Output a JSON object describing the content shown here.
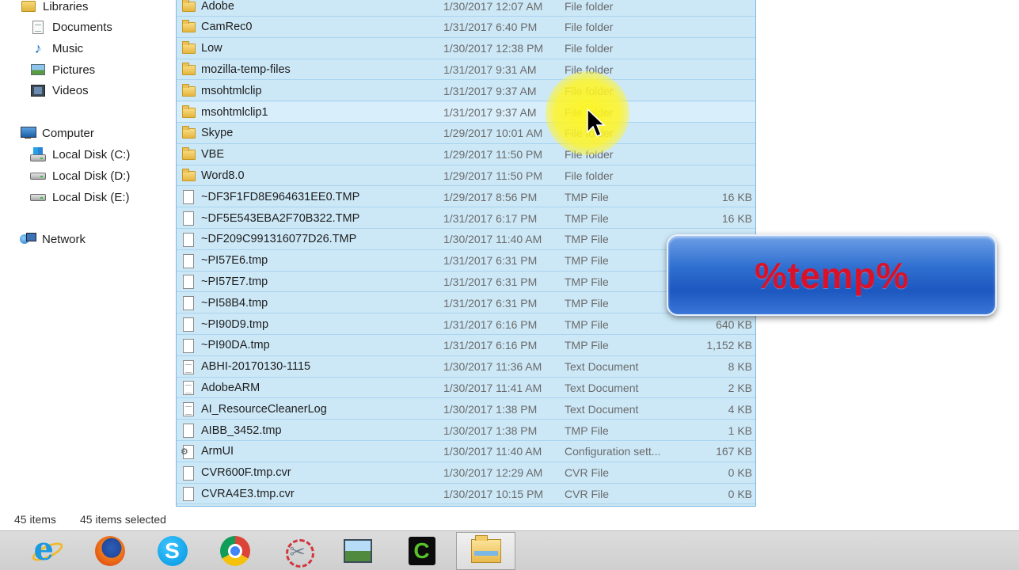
{
  "nav": {
    "items": [
      {
        "label": "Libraries",
        "icon": "libraries-icon"
      },
      {
        "label": "Documents",
        "icon": "documents-icon"
      },
      {
        "label": "Music",
        "icon": "music-icon"
      },
      {
        "label": "Pictures",
        "icon": "pictures-icon"
      },
      {
        "label": "Videos",
        "icon": "videos-icon"
      },
      {
        "label": "Computer",
        "icon": "computer-icon"
      },
      {
        "label": "Local Disk (C:)",
        "icon": "local-disk-c-icon"
      },
      {
        "label": "Local Disk (D:)",
        "icon": "local-disk-icon"
      },
      {
        "label": "Local Disk (E:)",
        "icon": "local-disk-icon"
      },
      {
        "label": "Network",
        "icon": "network-icon"
      }
    ]
  },
  "files": [
    {
      "name": "Adobe",
      "date": "1/30/2017 12:07 AM",
      "type": "File folder",
      "size": "",
      "kind": "folder"
    },
    {
      "name": "CamRec0",
      "date": "1/31/2017 6:40 PM",
      "type": "File folder",
      "size": "",
      "kind": "folder"
    },
    {
      "name": "Low",
      "date": "1/30/2017 12:38 PM",
      "type": "File folder",
      "size": "",
      "kind": "folder"
    },
    {
      "name": "mozilla-temp-files",
      "date": "1/31/2017 9:31 AM",
      "type": "File folder",
      "size": "",
      "kind": "folder"
    },
    {
      "name": "msohtmlclip",
      "date": "1/31/2017 9:37 AM",
      "type": "File folder",
      "size": "",
      "kind": "folder"
    },
    {
      "name": "msohtmlclip1",
      "date": "1/31/2017 9:37 AM",
      "type": "File folder",
      "size": "",
      "kind": "folder"
    },
    {
      "name": "Skype",
      "date": "1/29/2017 10:01 AM",
      "type": "File folder",
      "size": "",
      "kind": "folder"
    },
    {
      "name": "VBE",
      "date": "1/29/2017 11:50 PM",
      "type": "File folder",
      "size": "",
      "kind": "folder"
    },
    {
      "name": "Word8.0",
      "date": "1/29/2017 11:50 PM",
      "type": "File folder",
      "size": "",
      "kind": "folder"
    },
    {
      "name": "~DF3F1FD8E964631EE0.TMP",
      "date": "1/29/2017 8:56 PM",
      "type": "TMP File",
      "size": "16 KB",
      "kind": "file"
    },
    {
      "name": "~DF5E543EBA2F70B322.TMP",
      "date": "1/31/2017 6:17 PM",
      "type": "TMP File",
      "size": "16 KB",
      "kind": "file"
    },
    {
      "name": "~DF209C991316077D26.TMP",
      "date": "1/30/2017 11:40 AM",
      "type": "TMP File",
      "size": "",
      "kind": "file"
    },
    {
      "name": "~PI57E6.tmp",
      "date": "1/31/2017 6:31 PM",
      "type": "TMP File",
      "size": "",
      "kind": "file"
    },
    {
      "name": "~PI57E7.tmp",
      "date": "1/31/2017 6:31 PM",
      "type": "TMP File",
      "size": "",
      "kind": "file"
    },
    {
      "name": "~PI58B4.tmp",
      "date": "1/31/2017 6:31 PM",
      "type": "TMP File",
      "size": "",
      "kind": "file"
    },
    {
      "name": "~PI90D9.tmp",
      "date": "1/31/2017 6:16 PM",
      "type": "TMP File",
      "size": "640 KB",
      "kind": "file"
    },
    {
      "name": "~PI90DA.tmp",
      "date": "1/31/2017 6:16 PM",
      "type": "TMP File",
      "size": "1,152 KB",
      "kind": "file"
    },
    {
      "name": "ABHI-20170130-1115",
      "date": "1/30/2017 11:36 AM",
      "type": "Text Document",
      "size": "8 KB",
      "kind": "text"
    },
    {
      "name": "AdobeARM",
      "date": "1/30/2017 11:41 AM",
      "type": "Text Document",
      "size": "2 KB",
      "kind": "text"
    },
    {
      "name": "AI_ResourceCleanerLog",
      "date": "1/30/2017 1:38 PM",
      "type": "Text Document",
      "size": "4 KB",
      "kind": "text"
    },
    {
      "name": "AIBB_3452.tmp",
      "date": "1/30/2017 1:38 PM",
      "type": "TMP File",
      "size": "1 KB",
      "kind": "file"
    },
    {
      "name": "ArmUI",
      "date": "1/30/2017 11:40 AM",
      "type": "Configuration sett...",
      "size": "167 KB",
      "kind": "config"
    },
    {
      "name": "CVR600F.tmp.cvr",
      "date": "1/30/2017 12:29 AM",
      "type": "CVR File",
      "size": "0 KB",
      "kind": "file"
    },
    {
      "name": "CVRA4E3.tmp.cvr",
      "date": "1/30/2017 10:15 PM",
      "type": "CVR File",
      "size": "0 KB",
      "kind": "file"
    }
  ],
  "hover_row_index": 5,
  "banner": {
    "text": "%temp%",
    "text_color": "#d9122a",
    "background": "#2f6fd0"
  },
  "status": {
    "item_count": "45 items",
    "selected_count": "45 items selected"
  },
  "taskbar": {
    "apps": [
      {
        "name": "internet-explorer",
        "icon": "internet-explorer-icon",
        "active": false
      },
      {
        "name": "firefox",
        "icon": "firefox-icon",
        "active": false
      },
      {
        "name": "skype",
        "icon": "skype-icon",
        "active": false
      },
      {
        "name": "chrome",
        "icon": "chrome-icon",
        "active": false
      },
      {
        "name": "snipping-tool",
        "icon": "snipping-tool-icon",
        "active": false
      },
      {
        "name": "photo-viewer",
        "icon": "photo-viewer-icon",
        "active": false
      },
      {
        "name": "camtasia",
        "icon": "camtasia-icon",
        "active": false
      },
      {
        "name": "file-explorer",
        "icon": "file-explorer-icon",
        "active": true
      }
    ],
    "skype_glyph": "S",
    "camtasia_glyph": "C",
    "ie_glyph": "e"
  },
  "colors": {
    "selection": "#cce8f7",
    "selection_border": "#7cb7e0",
    "cursor_highlight": "#fff614"
  }
}
